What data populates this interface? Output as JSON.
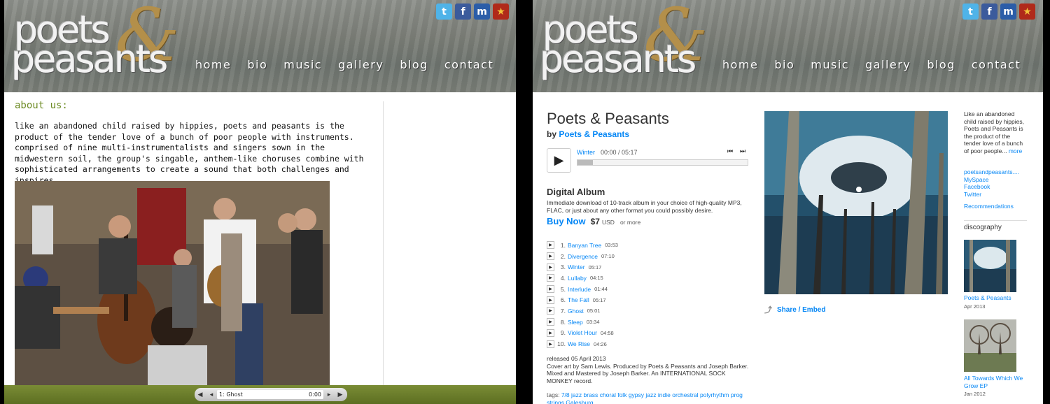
{
  "left_site": {
    "logo": {
      "line1": "poets",
      "amp": "&",
      "line2": "peasants"
    },
    "nav": [
      "home",
      "bio",
      "music",
      "gallery",
      "blog",
      "contact"
    ],
    "social_icons": [
      "twitter-icon",
      "facebook-icon",
      "myspace-icon",
      "reverbnation-icon"
    ],
    "about_heading": "about us:",
    "about_text": "like an abandoned child raised by hippies, poets and peasants is the product of the tender love of a bunch of poor people with instruments. comprised of nine multi-instrumentalists and singers sown in the midwestern soil, the group's singable, anthem-like choruses combine with sophisticated arrangements to create a sound that both challenges and inspires.",
    "player": {
      "track": "1: Ghost",
      "time": "0:00"
    }
  },
  "right_site": {
    "logo": {
      "line1": "poets",
      "amp": "&",
      "line2": "peasants"
    },
    "nav": [
      "home",
      "bio",
      "music",
      "gallery",
      "blog",
      "contact"
    ],
    "album": {
      "title": "Poets & Peasants",
      "by_label": "by",
      "artist": "Poets & Peasants",
      "player": {
        "track": "Winter",
        "time": "00:00 / 05:17",
        "progress": 0.09
      },
      "format": "Digital Album",
      "format_desc": "Immediate download of 10-track album in your choice of high-quality MP3, FLAC, or just about any other format you could possibly desire.",
      "buy_now": "Buy Now",
      "price": "$7",
      "currency": "USD",
      "or_more": "or more",
      "tracks": [
        {
          "num": "1.",
          "title": "Banyan Tree",
          "dur": "03:53"
        },
        {
          "num": "2.",
          "title": "Divergence",
          "dur": "07:10"
        },
        {
          "num": "3.",
          "title": "Winter",
          "dur": "05:17"
        },
        {
          "num": "4.",
          "title": "Lullaby",
          "dur": "04:15"
        },
        {
          "num": "5.",
          "title": "Interlude",
          "dur": "01:44"
        },
        {
          "num": "6.",
          "title": "The Fall",
          "dur": "05:17"
        },
        {
          "num": "7.",
          "title": "Ghost",
          "dur": "05:01"
        },
        {
          "num": "8.",
          "title": "Sleep",
          "dur": "03:34"
        },
        {
          "num": "9.",
          "title": "Violet Hour",
          "dur": "04:58"
        },
        {
          "num": "10.",
          "title": "We Rise",
          "dur": "04:26"
        }
      ],
      "released": "released 05 April 2013",
      "credits": "Cover art by Sam Lewis. Produced by Poets & Peasants and Joseph Barker. Mixed and Mastered by Joseph Barker. An INTERNATIONAL SOCK MONKEY record.",
      "tags_label": "tags:",
      "tags": [
        "7/8",
        "jazz",
        "brass",
        "choral",
        "folk",
        "gypsy jazz",
        "indie",
        "orchestral",
        "polyrhythm",
        "prog",
        "strings",
        "Galesburg"
      ],
      "share": "Share / Embed"
    },
    "sidebar": {
      "bio": "Like an abandoned child raised by hippies, Poets and Peasants is the product of the tender love of a bunch of poor people...",
      "more": "more",
      "links": [
        "poetsandpeasants....",
        "MySpace",
        "Facebook",
        "Twitter"
      ],
      "recommendations": "Recommendations",
      "discography_label": "discography",
      "discography": [
        {
          "title": "Poets & Peasants",
          "date": "Apr 2013"
        },
        {
          "title": "All Towards Which We Grow EP",
          "date": "Jan 2012"
        }
      ]
    }
  }
}
